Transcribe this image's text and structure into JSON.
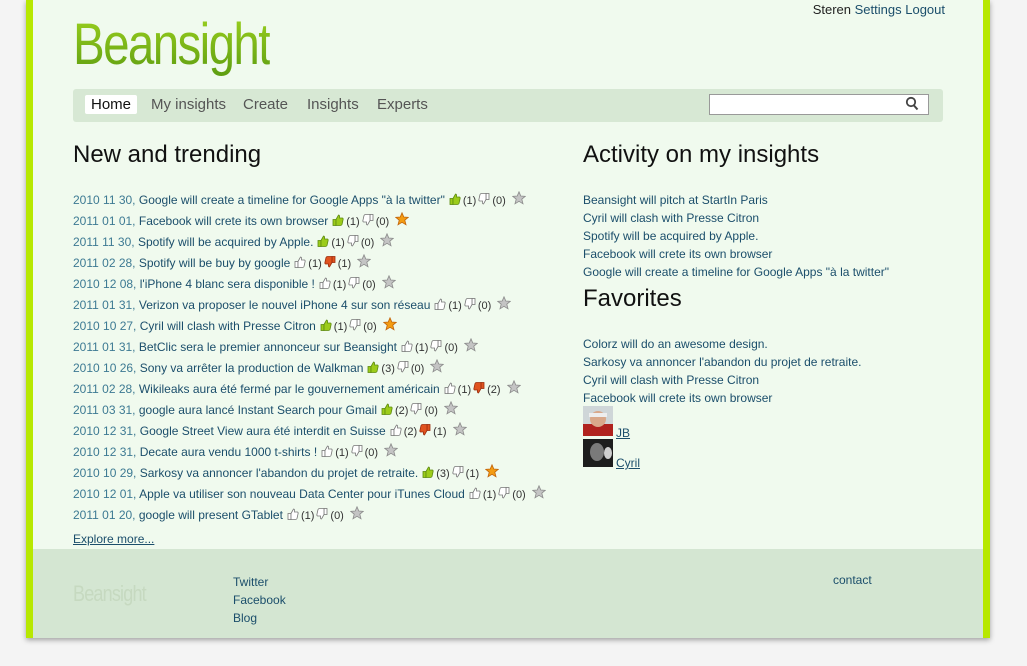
{
  "header": {
    "user": "Steren",
    "settings_label": "Settings",
    "logout_label": "Logout",
    "logo_text": "Beansight"
  },
  "nav": {
    "items": [
      {
        "label": "Home",
        "active": true
      },
      {
        "label": "My insights",
        "active": false
      },
      {
        "label": "Create",
        "active": false
      },
      {
        "label": "Insights",
        "active": false
      },
      {
        "label": "Experts",
        "active": false
      }
    ],
    "search_placeholder": ""
  },
  "trending": {
    "heading": "New and trending",
    "items": [
      {
        "date": "2010 11 30,",
        "title": "Google will create a timeline for Google Apps \"à la twitter\"",
        "agree": "(1)",
        "disagree": "(0)",
        "agree_on": true,
        "disagree_on": false,
        "fav": false
      },
      {
        "date": "2011 01 01,",
        "title": "Facebook will crete its own browser",
        "agree": "(1)",
        "disagree": "(0)",
        "agree_on": true,
        "disagree_on": false,
        "fav": true
      },
      {
        "date": "2011 11 30,",
        "title": "Spotify will be acquired by Apple.",
        "agree": "(1)",
        "disagree": "(0)",
        "agree_on": true,
        "disagree_on": false,
        "fav": false
      },
      {
        "date": "2011 02 28,",
        "title": "Spotify will be buy by google",
        "agree": "(1)",
        "disagree": "(1)",
        "agree_on": false,
        "disagree_on": true,
        "fav": false
      },
      {
        "date": "2010 12 08,",
        "title": "l'iPhone 4 blanc sera disponible !",
        "agree": "(1)",
        "disagree": "(0)",
        "agree_on": false,
        "disagree_on": false,
        "fav": false
      },
      {
        "date": "2011 01 31,",
        "title": "Verizon va proposer le nouvel iPhone 4 sur son réseau",
        "agree": "(1)",
        "disagree": "(0)",
        "agree_on": false,
        "disagree_on": false,
        "fav": false
      },
      {
        "date": "2010 10 27,",
        "title": "Cyril will clash with Presse Citron",
        "agree": "(1)",
        "disagree": "(0)",
        "agree_on": true,
        "disagree_on": false,
        "fav": true
      },
      {
        "date": "2011 01 31,",
        "title": "BetClic sera le premier annonceur sur Beansight",
        "agree": "(1)",
        "disagree": "(0)",
        "agree_on": false,
        "disagree_on": false,
        "fav": false
      },
      {
        "date": "2010 10 26,",
        "title": "Sony va arrêter la production de Walkman",
        "agree": "(3)",
        "disagree": "(0)",
        "agree_on": true,
        "disagree_on": false,
        "fav": false
      },
      {
        "date": "2011 02 28,",
        "title": "Wikileaks aura été fermé par le gouvernement américain",
        "agree": "(1)",
        "disagree": "(2)",
        "agree_on": false,
        "disagree_on": true,
        "fav": false
      },
      {
        "date": "2011 03 31,",
        "title": "google aura lancé Instant Search pour Gmail",
        "agree": "(2)",
        "disagree": "(0)",
        "agree_on": true,
        "disagree_on": false,
        "fav": false
      },
      {
        "date": "2010 12 31,",
        "title": "Google Street View aura été interdit en Suisse",
        "agree": "(2)",
        "disagree": "(1)",
        "agree_on": false,
        "disagree_on": true,
        "fav": false
      },
      {
        "date": "2010 12 31,",
        "title": "Decate aura vendu 1000 t-shirts !",
        "agree": "(1)",
        "disagree": "(0)",
        "agree_on": false,
        "disagree_on": false,
        "fav": false
      },
      {
        "date": "2010 10 29,",
        "title": "Sarkosy va annoncer l'abandon du projet de retraite.",
        "agree": "(3)",
        "disagree": "(1)",
        "agree_on": true,
        "disagree_on": false,
        "fav": true
      },
      {
        "date": "2010 12 01,",
        "title": "Apple va utiliser son nouveau Data Center pour iTunes Cloud",
        "agree": "(1)",
        "disagree": "(0)",
        "agree_on": false,
        "disagree_on": false,
        "fav": false,
        "wrap": true
      },
      {
        "date": "2011 01 20,",
        "title": "google will present GTablet",
        "agree": "(1)",
        "disagree": "(0)",
        "agree_on": false,
        "disagree_on": false,
        "fav": false
      }
    ],
    "explore_label": "Explore more..."
  },
  "activity": {
    "heading": "Activity on my insights",
    "items": [
      "Beansight will pitch at StartIn Paris",
      "Cyril will clash with Presse Citron",
      "Spotify will be acquired by Apple.",
      "Facebook will crete its own browser",
      "Google will create a timeline for Google Apps \"à la twitter\""
    ]
  },
  "favorites": {
    "heading": "Favorites",
    "items": [
      "Colorz will do an awesome design.",
      "Sarkosy va annoncer l'abandon du projet de retraite.",
      "Cyril will clash with Presse Citron",
      "Facebook will crete its own browser"
    ],
    "users": [
      {
        "name": "JB"
      },
      {
        "name": "Cyril"
      }
    ]
  },
  "footer": {
    "logo_text": "Beansight",
    "links": [
      "Twitter",
      "Facebook",
      "Blog"
    ],
    "contact_label": "contact"
  },
  "colors": {
    "accent": "#b7e800",
    "link": "#1b4e6b",
    "date": "#3d7a93",
    "agree_on": "#9ccc1a",
    "disagree_on": "#e0531f",
    "fav_on": "#f39c12"
  }
}
